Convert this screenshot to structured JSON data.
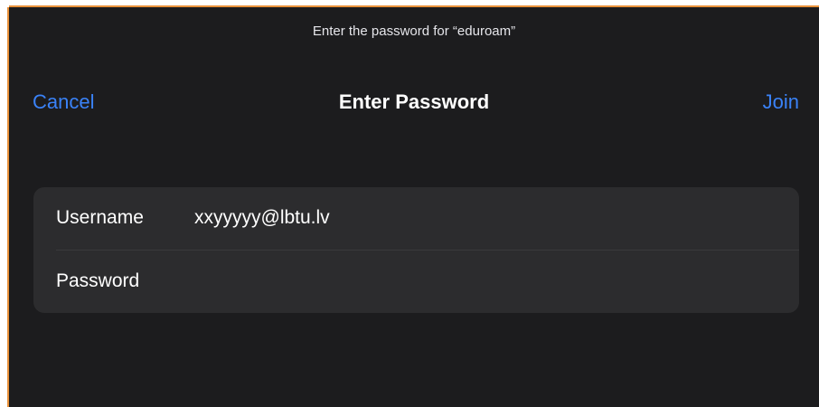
{
  "prompt": "Enter the password for “eduroam”",
  "nav": {
    "cancel_label": "Cancel",
    "title": "Enter Password",
    "join_label": "Join"
  },
  "form": {
    "username": {
      "label": "Username",
      "value": "xxyyyyy@lbtu.lv"
    },
    "password": {
      "label": "Password",
      "value": "",
      "placeholder": ""
    }
  },
  "colors": {
    "background": "#1c1c1e",
    "group_background": "#2c2c2e",
    "accent": "#3a82f7",
    "frame_border": "#e8913a"
  }
}
